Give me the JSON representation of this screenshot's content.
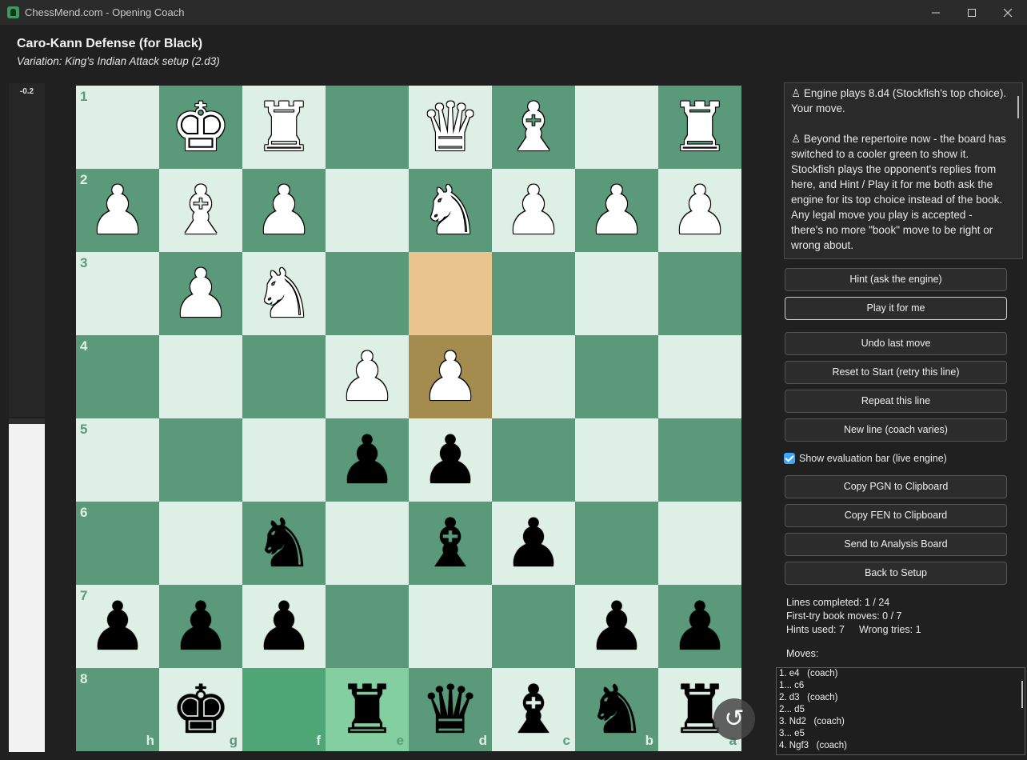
{
  "window": {
    "title": "ChessMend.com - Opening Coach",
    "minimize": "—",
    "maximize": "☐",
    "close": "✕"
  },
  "header": {
    "opening": "Caro-Kann Defense (for Black)",
    "variation": "Variation: King's Indian Attack setup (2.d3)"
  },
  "eval": {
    "value": "-0.2"
  },
  "colors": {
    "light_square": "#def0e5",
    "dark_square": "#5a9a7a",
    "last_move_from": "#eac48e",
    "last_move_to": "#a38c4d",
    "highlight_f8": "#4ea677",
    "highlight_e8": "#84cfa0"
  },
  "board": {
    "orientation": "black",
    "rank_labels": [
      "1",
      "2",
      "3",
      "4",
      "5",
      "6",
      "7",
      "8"
    ],
    "file_labels": [
      "h",
      "g",
      "f",
      "e",
      "d",
      "c",
      "b",
      "a"
    ],
    "rows": [
      [
        "",
        "wK",
        "wR",
        "",
        "wQ",
        "wB",
        "",
        "wR"
      ],
      [
        "wP",
        "wB",
        "wP",
        "",
        "wN",
        "wP",
        "wP",
        "wP"
      ],
      [
        "",
        "wP",
        "wN",
        "",
        "",
        "",
        "",
        ""
      ],
      [
        "",
        "",
        "",
        "wP",
        "wP",
        "",
        "",
        ""
      ],
      [
        "",
        "",
        "",
        "bP",
        "bP",
        "",
        "",
        ""
      ],
      [
        "",
        "",
        "bN",
        "",
        "bB",
        "bP",
        "",
        ""
      ],
      [
        "bP",
        "bP",
        "bP",
        "",
        "",
        "",
        "bP",
        "bP"
      ],
      [
        "",
        "bK",
        "",
        "bR",
        "bQ",
        "bB",
        "bN",
        "bR"
      ]
    ]
  },
  "coach_messages": [
    "♙ Engine plays 8.d4 (Stockfish's top choice). Your move.",
    "♙ Beyond the repertoire now - the board has switched to a cooler green to show it. Stockfish plays the opponent's replies from here, and Hint / Play it for me both ask the engine for its top choice instead of the book. Any legal move you play is accepted - there's no more \"book\" move to be right or wrong about."
  ],
  "buttons": {
    "hint": "Hint (ask the engine)",
    "play_for_me": "Play it for me",
    "undo": "Undo last move",
    "reset": "Reset to Start (retry this line)",
    "repeat": "Repeat this line",
    "new_line": "New line (coach varies)",
    "copy_pgn": "Copy PGN to Clipboard",
    "copy_fen": "Copy FEN to Clipboard",
    "analysis": "Send to Analysis Board",
    "back": "Back to Setup"
  },
  "settings": {
    "show_eval_label": "Show evaluation bar (live engine)",
    "show_eval_checked": true
  },
  "stats": {
    "lines_completed": "Lines completed: 1 / 24",
    "first_try": "First-try book moves: 0 / 7",
    "hints_used": "Hints used: 7",
    "wrong_tries": "Wrong tries: 1"
  },
  "moves": {
    "label": "Moves:",
    "list": [
      "1. e4   (coach)",
      "1... c6",
      "2. d3   (coach)",
      "2... d5",
      "3. Nd2   (coach)",
      "3... e5",
      "4. Ngf3   (coach)"
    ]
  },
  "flip_icon": "↺"
}
